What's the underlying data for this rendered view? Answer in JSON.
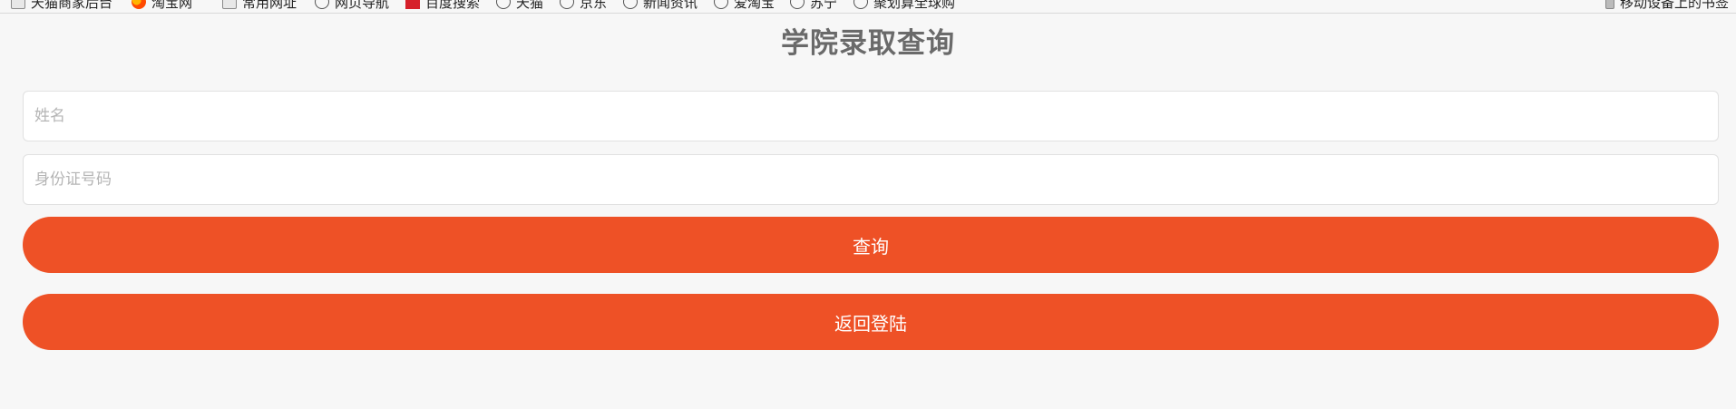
{
  "bookmarks_bar": {
    "items": [
      {
        "label": "天猫商家后台",
        "icon": "folder-icon"
      },
      {
        "label": "淘宝网",
        "icon": "taobao-icon"
      },
      {
        "label": "常用网址",
        "icon": "folder-icon"
      },
      {
        "label": "网页导航",
        "icon": "globe-icon"
      },
      {
        "label": "百度搜索",
        "icon": "red-logo-icon"
      },
      {
        "label": "天猫",
        "icon": "globe-icon"
      },
      {
        "label": "京东",
        "icon": "globe-icon"
      },
      {
        "label": "新闻资讯",
        "icon": "globe-icon"
      },
      {
        "label": "爱淘宝",
        "icon": "globe-icon"
      },
      {
        "label": "苏宁",
        "icon": "globe-icon"
      },
      {
        "label": "聚划算全球购",
        "icon": "globe-icon"
      }
    ],
    "mobile_bookmarks": {
      "label": "移动设备上的书签",
      "icon": "phone-icon"
    }
  },
  "page": {
    "title": "学院录取查询"
  },
  "form": {
    "name_placeholder": "姓名",
    "name_value": "",
    "id_placeholder": "身份证号码",
    "id_value": "",
    "query_button": "查询",
    "back_button": "返回登陆"
  },
  "colors": {
    "background": "#f7f7f7",
    "accent": "#ee5126",
    "title": "#6a6a6a",
    "placeholder": "#b5b5b5"
  }
}
